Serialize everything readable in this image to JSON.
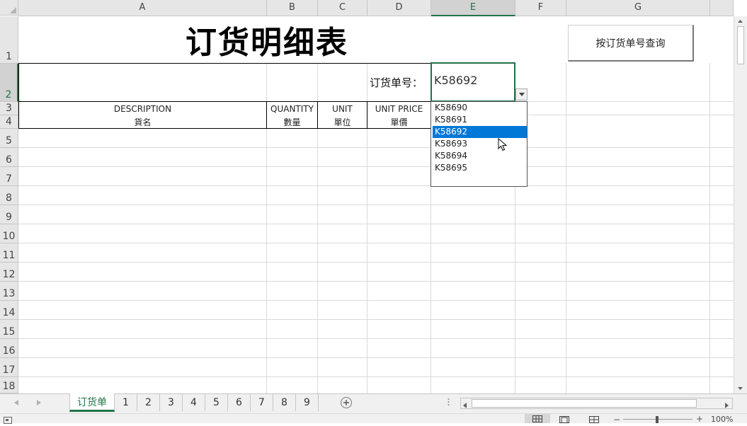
{
  "column_headers": [
    "A",
    "B",
    "C",
    "D",
    "E",
    "F",
    "G"
  ],
  "row_headers": [
    "1",
    "2",
    "3",
    "4",
    "5",
    "6",
    "7",
    "8",
    "9",
    "10",
    "11",
    "12",
    "13",
    "14",
    "15",
    "16",
    "17",
    "18"
  ],
  "sheet": {
    "title": "订货明细表",
    "query_button": "按订货单号查询",
    "order_label": "订货单号：",
    "order_value": "K58692",
    "table_headers": [
      {
        "en": "DESCRIPTION",
        "zh": "貨名"
      },
      {
        "en": "QUANTITY",
        "zh": "數量"
      },
      {
        "en": "UNIT",
        "zh": "單位"
      },
      {
        "en": "UNIT PRICE",
        "zh": "單價"
      }
    ]
  },
  "dropdown": {
    "options": [
      "K58690",
      "K58691",
      "K58692",
      "K58693",
      "K58694",
      "K58695"
    ],
    "selected": "K58692"
  },
  "tabs": [
    "订货单",
    "1",
    "2",
    "3",
    "4",
    "5",
    "6",
    "7",
    "8",
    "9"
  ],
  "active_tab": "订货单",
  "zoom": "100%",
  "colors": {
    "accent": "#217346",
    "selection": "#0078d7"
  }
}
